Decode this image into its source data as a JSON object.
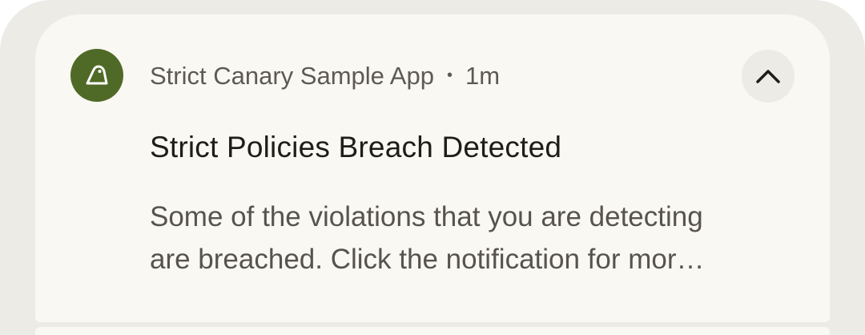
{
  "notification": {
    "app_name": "Strict Canary Sample App",
    "separator": "•",
    "time": "1m",
    "title": "Strict Policies Breach Detected",
    "body_lines": [
      "Some of the violations that you are detecting",
      "are breached. Click the notification for mor…"
    ],
    "app_icon": "canary-bird-icon",
    "expand_icon": "chevron-up-icon"
  },
  "colors": {
    "shade_background": "#ecebe6",
    "card_background": "#faf8f3",
    "app_icon_background": "#4f6a26",
    "title_text": "#1e1d19",
    "secondary_text": "#5c5a52"
  }
}
